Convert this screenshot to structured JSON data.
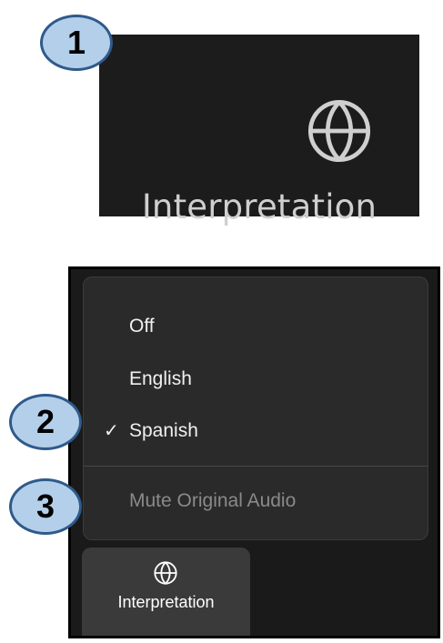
{
  "callouts": [
    "1",
    "2",
    "3"
  ],
  "toolbar_button": {
    "icon": "globe-icon",
    "label": "Interpretation"
  },
  "dropdown": {
    "items": [
      {
        "label": "Off",
        "checked": false,
        "enabled": true
      },
      {
        "label": "English",
        "checked": false,
        "enabled": true
      },
      {
        "label": "Spanish",
        "checked": true,
        "enabled": true
      }
    ],
    "mute_original": {
      "label": "Mute Original Audio",
      "enabled": false
    },
    "check_glyph": "✓"
  },
  "toolbar_button_small": {
    "icon": "globe-icon",
    "label": "Interpretation"
  },
  "colors": {
    "callout_fill": "#b3cfea",
    "callout_border": "#2f5a8a",
    "toolbar_background": "#1c1c1c",
    "menu_background": "#2a2a2a"
  }
}
